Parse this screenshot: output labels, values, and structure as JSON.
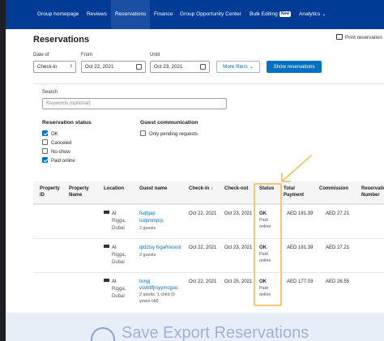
{
  "nav": {
    "items": [
      {
        "label": "Group homepage"
      },
      {
        "label": "Reviews"
      },
      {
        "label": "Reservations",
        "active": true
      },
      {
        "label": "Finance"
      },
      {
        "label": "Group Opportunity Center"
      },
      {
        "label": "Bulk Editing",
        "badge": "New"
      },
      {
        "label": "Analytics"
      }
    ]
  },
  "page": {
    "title": "Reservations",
    "print_label": "Print reservation"
  },
  "filters": {
    "date_of_label": "Date of",
    "date_of_value": "Check-in",
    "from_label": "From",
    "from_value": "Oct 22, 2021",
    "until_label": "Until",
    "until_value": "Oct 23, 2021",
    "more_filters_label": "More filters",
    "show_button_label": "Show reservations"
  },
  "search": {
    "label": "Search",
    "placeholder": "Keywords (optional)"
  },
  "reservation_status": {
    "title": "Reservation status",
    "options": [
      {
        "label": "OK",
        "checked": true
      },
      {
        "label": "Canceled",
        "checked": false
      },
      {
        "label": "No-show",
        "checked": false
      },
      {
        "label": "Paid online",
        "checked": true
      }
    ]
  },
  "guest_communication": {
    "title": "Guest communication",
    "option_label": "Only pending requests",
    "checked": false
  },
  "table": {
    "headers": {
      "property_id": "Property ID",
      "property_name": "Property Name",
      "location": "Location",
      "guest_name": "Guest name",
      "check_in": "Check-in",
      "check_out": "Check-out",
      "status": "Status",
      "total_payment": "Total Payment",
      "commission": "Commission",
      "reservation_number": "Reservation Number"
    },
    "rows": [
      {
        "location_1": "Al",
        "location_2": "Rigga,",
        "location_3": "Dubai",
        "guest_1": "fsqfgap",
        "guest_2": "lsdpmmprp",
        "guest_3": "2 guests",
        "guest_4": "",
        "check_in": "Oct 22, 2021",
        "check_out": "Oct 23, 2021",
        "status_1": "OK",
        "status_2": "Paid",
        "status_3": "online",
        "total": "AED 181.39",
        "commission": "AED 27.21"
      },
      {
        "location_1": "Al",
        "location_2": "Rigga,",
        "location_3": "Dubai",
        "guest_1": "qtdztsy fsgafrooxstr",
        "guest_2": "2 guests",
        "guest_3": "",
        "guest_4": "",
        "check_in": "Oct 22, 2021",
        "check_out": "Oct 23, 2021",
        "status_1": "OK",
        "status_2": "Paid",
        "status_3": "online",
        "total": "AED 181.39",
        "commission": "AED 27.21"
      },
      {
        "location_1": "Al",
        "location_2": "Rigga,",
        "location_3": "Dubai",
        "guest_1": "lisnyj",
        "guest_2": "vsvbtlfjrsyymcguu",
        "guest_3": "2 adults, 1 child (0",
        "guest_4": "years old)",
        "check_in": "Oct 22, 2021",
        "check_out": "Oct 25, 2021",
        "status_1": "OK",
        "status_2": "Paid",
        "status_3": "online",
        "total": "AED 177.03",
        "commission": "AED 26.55"
      }
    ]
  },
  "overlay": {
    "bottom_caption": "Save Export Reservations",
    "annotation_color": "#f0c87a"
  },
  "colors": {
    "nav_bg": "#003b95",
    "accent": "#0071c2"
  }
}
